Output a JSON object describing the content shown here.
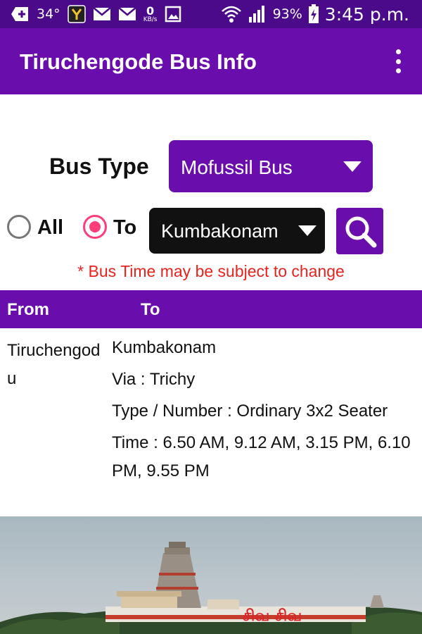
{
  "status_bar": {
    "temperature": "34°",
    "network_speed_value": "0",
    "network_speed_unit": "KB/s",
    "battery_percent": "93%",
    "time": "3:45 p.m."
  },
  "app_bar": {
    "title": "Tiruchengode Bus Info"
  },
  "form": {
    "bus_type_label": "Bus Type",
    "bus_type_value": "Mofussil Bus",
    "radio_all_label": "All",
    "radio_to_label": "To",
    "selected_radio": "To",
    "destination_value": "Kumbakonam",
    "disclaimer": "* Bus Time may be subject to change"
  },
  "table": {
    "headers": {
      "from": "From",
      "to": "To"
    },
    "rows": [
      {
        "from": "Tiruchengodu",
        "to": "Kumbakonam",
        "via": "Via : Trichy",
        "type_number": "Type / Number :  Ordinary 3x2 Seater",
        "time": "Time : 6.50 AM,  9.12 AM,  3.15 PM,  6.10 PM,  9.55 PM"
      }
    ]
  },
  "photo": {
    "sign_text": "சிவ சிவ"
  },
  "colors": {
    "status_bar": "#4a0a8a",
    "primary": "#6a0dad",
    "dark_select": "#111111",
    "radio_accent": "#ff3d7a",
    "warning_text": "#e8231e"
  },
  "icons": [
    "add-notification-icon",
    "app-y-icon",
    "mail-icon",
    "mail-icon",
    "image-icon",
    "wifi-icon",
    "signal-icon",
    "battery-icon",
    "overflow-menu-icon",
    "dropdown-caret-icon",
    "search-icon"
  ]
}
